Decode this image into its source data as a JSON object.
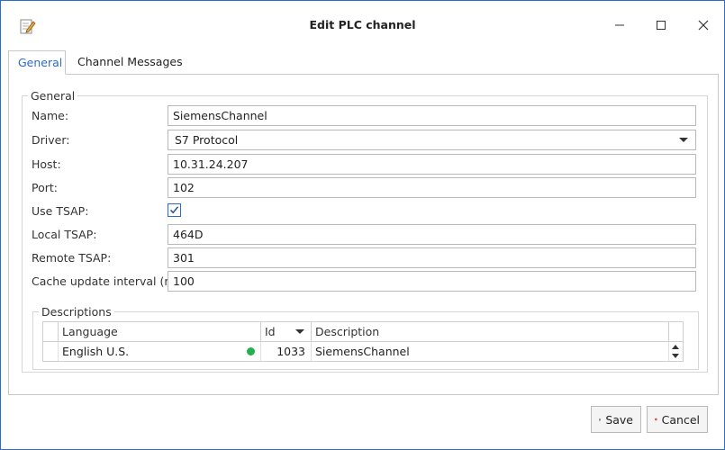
{
  "window": {
    "title": "Edit PLC channel",
    "app_icon": "edit-document-icon"
  },
  "tabs": [
    {
      "label": "General",
      "selected": true
    },
    {
      "label": "Channel Messages",
      "selected": false
    }
  ],
  "general": {
    "legend": "General",
    "fields": {
      "name": {
        "label": "Name:",
        "value": "SiemensChannel"
      },
      "driver": {
        "label": "Driver:",
        "value": "S7 Protocol"
      },
      "host": {
        "label": "Host:",
        "value": "10.31.24.207"
      },
      "port": {
        "label": "Port:",
        "value": "102"
      },
      "use_tsap": {
        "label": "Use TSAP:",
        "checked": true
      },
      "local_tsap": {
        "label": "Local TSAP:",
        "value": "464D"
      },
      "remote_tsap": {
        "label": "Remote TSAP:",
        "value": "301"
      },
      "cache_interval": {
        "label": "Cache update interval (ms):",
        "value": "100"
      }
    }
  },
  "descriptions": {
    "legend": "Descriptions",
    "columns": [
      "Language",
      "Id",
      "Description"
    ],
    "rows": [
      {
        "language": "English U.S.",
        "id": "1033",
        "description": "SiemensChannel",
        "status_color": "#22b14c"
      }
    ]
  },
  "buttons": {
    "save": "Save",
    "cancel": "Cancel"
  },
  "colors": {
    "accent": "#2b6cc4",
    "status_ok": "#22b14c",
    "cancel_icon": "#d9342b"
  }
}
